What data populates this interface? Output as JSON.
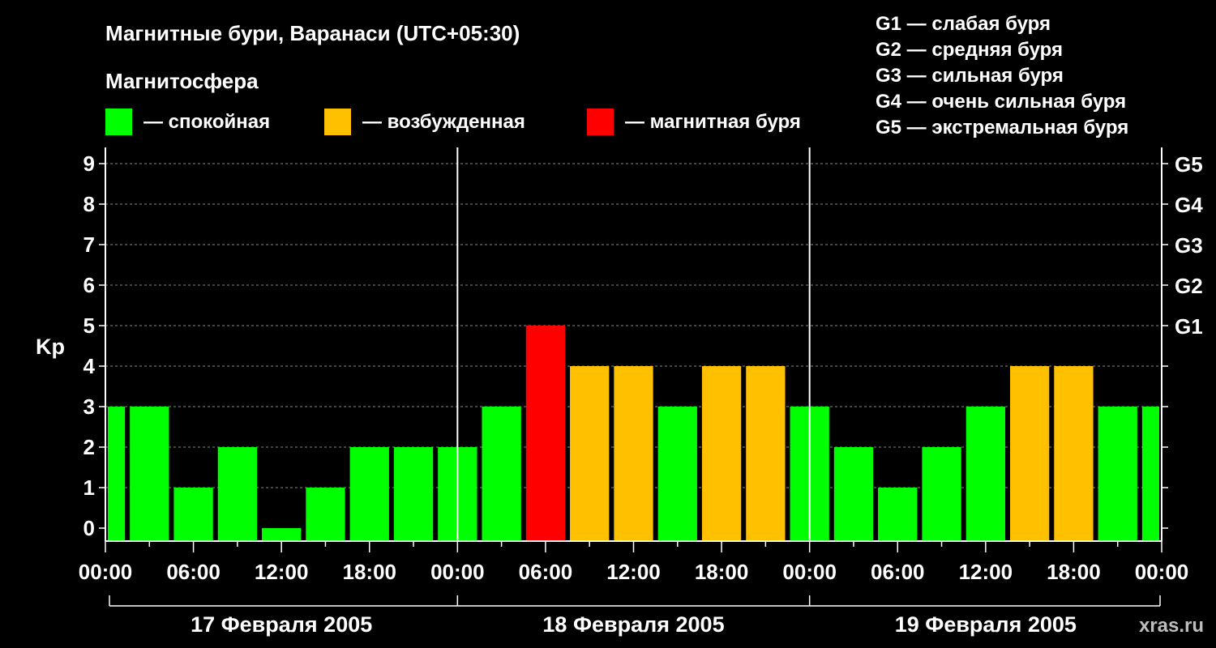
{
  "header": {
    "title": "Магнитные бури, Варанаси (UTC+05:30)",
    "legend_heading": "Магнитосфера"
  },
  "legend": [
    {
      "label": "— спокойная",
      "color": "#00ff00"
    },
    {
      "label": "— возбужденная",
      "color": "#ffc000"
    },
    {
      "label": "— магнитная буря",
      "color": "#ff0000"
    }
  ],
  "storm_scale": [
    "G1 — слабая буря",
    "G2 — средняя буря",
    "G3 — сильная буря",
    "G4 — очень сильная буря",
    "G5 — экстремальная буря"
  ],
  "watermark": "xras.ru",
  "chart_data": {
    "type": "bar",
    "title": "Магнитные бури, Варанаси (UTC+05:30)",
    "ylabel": "Kp",
    "ylim": [
      0,
      9
    ],
    "yticks": [
      "0",
      "1",
      "2",
      "3",
      "4",
      "5",
      "6",
      "7",
      "8",
      "9"
    ],
    "right_axis": [
      {
        "value": 5,
        "label": "G1"
      },
      {
        "value": 6,
        "label": "G2"
      },
      {
        "value": 7,
        "label": "G3"
      },
      {
        "value": 8,
        "label": "G4"
      },
      {
        "value": 9,
        "label": "G5"
      }
    ],
    "grid": true,
    "x_range_hours": [
      0,
      72
    ],
    "xticks": [
      {
        "hour": 0,
        "label": "00:00"
      },
      {
        "hour": 6,
        "label": "06:00"
      },
      {
        "hour": 12,
        "label": "12:00"
      },
      {
        "hour": 18,
        "label": "18:00"
      },
      {
        "hour": 24,
        "label": "00:00"
      },
      {
        "hour": 30,
        "label": "06:00"
      },
      {
        "hour": 36,
        "label": "12:00"
      },
      {
        "hour": 42,
        "label": "18:00"
      },
      {
        "hour": 48,
        "label": "00:00"
      },
      {
        "hour": 54,
        "label": "06:00"
      },
      {
        "hour": 60,
        "label": "12:00"
      },
      {
        "hour": 66,
        "label": "18:00"
      },
      {
        "hour": 72,
        "label": "00:00"
      }
    ],
    "days": [
      {
        "label": "17 Февраля 2005",
        "start": 0,
        "end": 24
      },
      {
        "label": "18 Февраля 2005",
        "start": 24,
        "end": 48
      },
      {
        "label": "19 Февраля 2005",
        "start": 48,
        "end": 72
      }
    ],
    "bars": [
      {
        "start": 0,
        "end": 1.5,
        "value": 3,
        "level": "quiet"
      },
      {
        "start": 1.5,
        "end": 4.5,
        "value": 3,
        "level": "quiet"
      },
      {
        "start": 4.5,
        "end": 7.5,
        "value": 1,
        "level": "quiet"
      },
      {
        "start": 7.5,
        "end": 10.5,
        "value": 2,
        "level": "quiet"
      },
      {
        "start": 10.5,
        "end": 13.5,
        "value": 0,
        "level": "quiet"
      },
      {
        "start": 13.5,
        "end": 16.5,
        "value": 1,
        "level": "quiet"
      },
      {
        "start": 16.5,
        "end": 19.5,
        "value": 2,
        "level": "quiet"
      },
      {
        "start": 19.5,
        "end": 22.5,
        "value": 2,
        "level": "quiet"
      },
      {
        "start": 22.5,
        "end": 25.5,
        "value": 2,
        "level": "quiet"
      },
      {
        "start": 25.5,
        "end": 28.5,
        "value": 3,
        "level": "quiet"
      },
      {
        "start": 28.5,
        "end": 31.5,
        "value": 5,
        "level": "storm"
      },
      {
        "start": 31.5,
        "end": 34.5,
        "value": 4,
        "level": "active"
      },
      {
        "start": 34.5,
        "end": 37.5,
        "value": 4,
        "level": "active"
      },
      {
        "start": 37.5,
        "end": 40.5,
        "value": 3,
        "level": "quiet"
      },
      {
        "start": 40.5,
        "end": 43.5,
        "value": 4,
        "level": "active"
      },
      {
        "start": 43.5,
        "end": 46.5,
        "value": 4,
        "level": "active"
      },
      {
        "start": 46.5,
        "end": 49.5,
        "value": 3,
        "level": "quiet"
      },
      {
        "start": 49.5,
        "end": 52.5,
        "value": 2,
        "level": "quiet"
      },
      {
        "start": 52.5,
        "end": 55.5,
        "value": 1,
        "level": "quiet"
      },
      {
        "start": 55.5,
        "end": 58.5,
        "value": 2,
        "level": "quiet"
      },
      {
        "start": 58.5,
        "end": 61.5,
        "value": 3,
        "level": "quiet"
      },
      {
        "start": 61.5,
        "end": 64.5,
        "value": 4,
        "level": "active"
      },
      {
        "start": 64.5,
        "end": 67.5,
        "value": 4,
        "level": "active"
      },
      {
        "start": 67.5,
        "end": 70.5,
        "value": 3,
        "level": "quiet"
      },
      {
        "start": 70.5,
        "end": 72,
        "value": 3,
        "level": "quiet"
      }
    ],
    "level_colors": {
      "quiet": "#00ff00",
      "active": "#ffc000",
      "storm": "#ff0000"
    }
  }
}
